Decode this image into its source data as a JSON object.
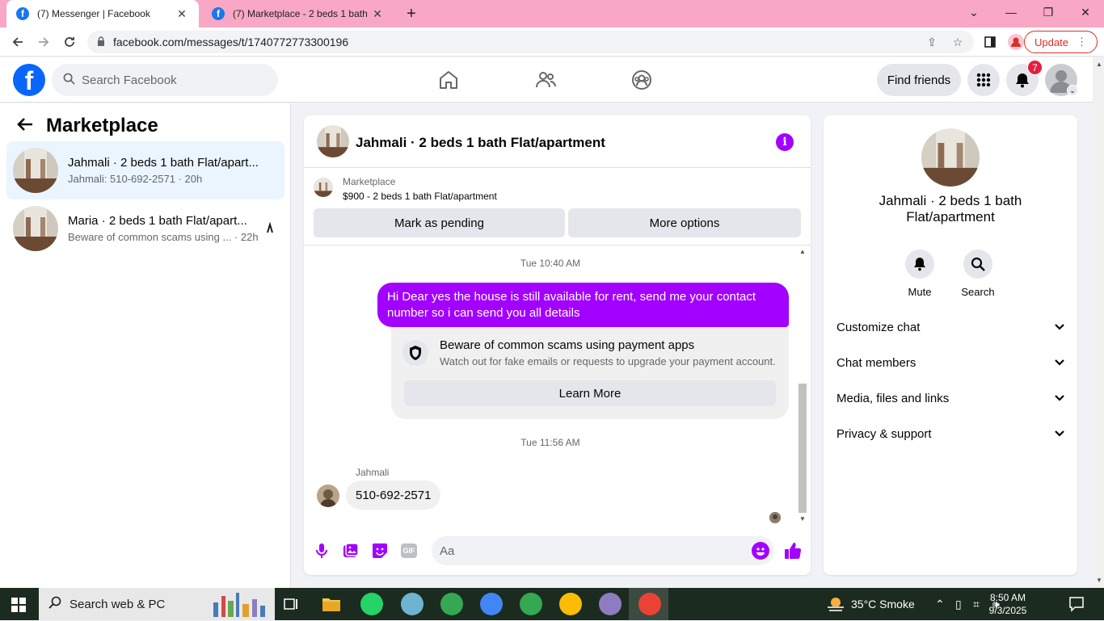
{
  "browser": {
    "tabs": [
      {
        "title": "(7) Messenger | Facebook",
        "active": true
      },
      {
        "title": "(7) Marketplace - 2 beds 1 bath F",
        "active": false
      }
    ],
    "new_tab": "+",
    "url": "facebook.com/messages/t/1740772773300196",
    "update_label": "Update"
  },
  "fb": {
    "search_placeholder": "Search Facebook",
    "find_friends": "Find friends",
    "notif_count": "7",
    "accent": "#a200ff",
    "brand": "#0866ff"
  },
  "sidebar": {
    "title": "Marketplace",
    "conversations": [
      {
        "name": "Jahmali · 2 beds 1 bath Flat/apart...",
        "sub": "Jahmali: 510-692-2571 · 20h",
        "selected": true
      },
      {
        "name": "Maria · 2 beds 1 bath Flat/apart...",
        "sub": "Beware of common scams using ...  · 22h",
        "selected": false
      }
    ]
  },
  "chat": {
    "title": "Jahmali · 2 beds 1 bath Flat/apartment",
    "strip_label": "Marketplace",
    "strip_price": "$900 - 2 beds 1 bath Flat/apartment",
    "mark_pending": "Mark as pending",
    "more_options": "More options",
    "time1": "Tue 10:40 AM",
    "outgoing": "Hi Dear yes the house is still available for rent, send me your contact number so i can send you all details",
    "scam_title": "Beware of common scams using payment apps",
    "scam_desc": "Watch out for fake emails or requests to upgrade your payment account.",
    "learn_more": "Learn More",
    "time2": "Tue 11:56 AM",
    "sender": "Jahmali",
    "incoming": "510-692-2571",
    "composer_placeholder": "Aa",
    "gif_label": "GIF"
  },
  "details": {
    "title": "Jahmali · 2 beds 1 bath Flat/apartment",
    "mute": "Mute",
    "search": "Search",
    "rows": [
      "Customize chat",
      "Chat members",
      "Media, files and links",
      "Privacy & support"
    ]
  },
  "taskbar": {
    "search_text": "Search web & PC",
    "weather": "35°C  Smoke",
    "time": "8:50 AM",
    "date": "9/3/2025"
  }
}
